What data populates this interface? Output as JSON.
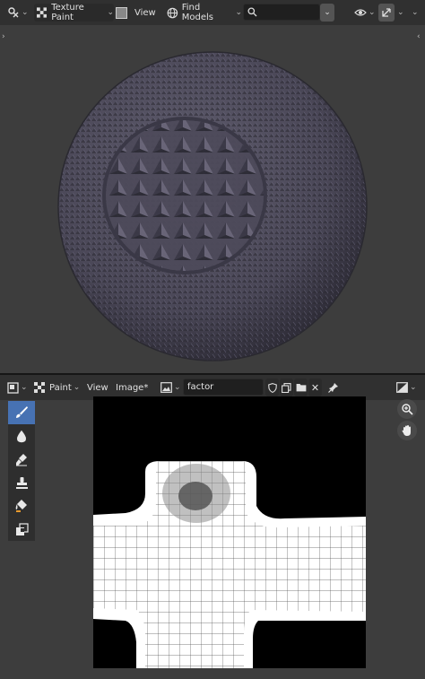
{
  "viewport": {
    "editor_type_icon": "viewport-editor-icon",
    "mode_label": "Texture Paint",
    "view_label": "View",
    "asset_menu_label": "Find Models",
    "search_placeholder": ""
  },
  "image_editor": {
    "editor_type_icon": "image-editor-icon",
    "mode_label": "Paint",
    "view_label": "View",
    "image_label": "Image*",
    "image_name": "factor"
  },
  "tools": [
    {
      "name": "draw-tool",
      "icon": "brush-icon",
      "active": true
    },
    {
      "name": "soften-tool",
      "icon": "drop-icon",
      "active": false
    },
    {
      "name": "smear-tool",
      "icon": "smear-icon",
      "active": false
    },
    {
      "name": "clone-tool",
      "icon": "stamp-icon",
      "active": false
    },
    {
      "name": "fill-tool",
      "icon": "bucket-icon",
      "active": false
    },
    {
      "name": "mask-tool",
      "icon": "mask-icon",
      "active": false
    }
  ],
  "colors": {
    "header_bg": "#303030",
    "area_bg": "#3d3d3d",
    "active_tool": "#4772b3",
    "sphere": "#4a4855"
  }
}
